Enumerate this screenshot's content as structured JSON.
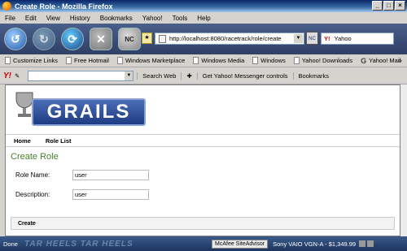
{
  "window": {
    "title": "Create Role - Mozilla Firefox"
  },
  "menu": [
    "File",
    "Edit",
    "View",
    "History",
    "Bookmarks",
    "Yahoo!",
    "Tools",
    "Help"
  ],
  "address": {
    "url": "http://localhost:8080/racetrack/role/create"
  },
  "search": {
    "engine": "Yahoo"
  },
  "bookmarks": [
    "Customize Links",
    "Free Hotmail",
    "Windows Marketplace",
    "Windows Media",
    "Windows",
    "Yahoo! Downloads",
    "Yahoo! Mail"
  ],
  "yahoo_toolbar": {
    "search_web": "Search Web",
    "messenger": "Get Yahoo! Messenger controls",
    "bookmarks": "Bookmarks"
  },
  "app": {
    "logo_text": "GRAILS",
    "nav": [
      "Home",
      "Role List"
    ],
    "title": "Create Role",
    "fields": [
      {
        "label": "Role Name:",
        "value": "user"
      },
      {
        "label": "Description:",
        "value": "user"
      }
    ],
    "create_label": "Create"
  },
  "status": {
    "text": "Done",
    "watermark": "TAR HEELS   TAR HEELS",
    "mcafee": "McAfee SiteAdvisor",
    "ad": "Sony VAIO VGN-A - $1,349.99"
  }
}
